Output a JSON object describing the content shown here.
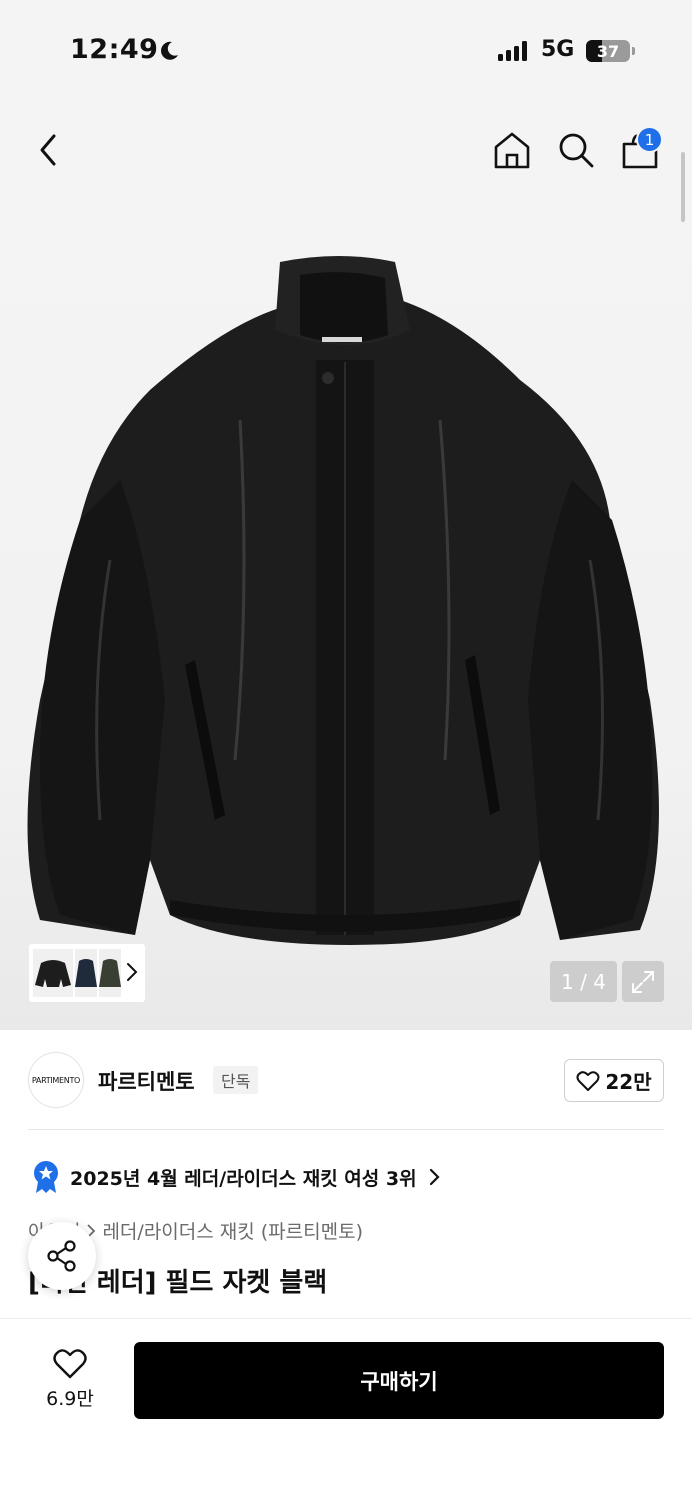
{
  "status_bar": {
    "time": "12:49",
    "network": "5G",
    "battery": "37"
  },
  "gallery": {
    "counter": "1 / 4",
    "cart_count": "1"
  },
  "brand": {
    "logo_text": "PARTIMENTO",
    "name": "파르티멘토",
    "tag": "단독",
    "likes": "22만"
  },
  "ranking": {
    "text": "2025년 4월 레더/라이더스 재킷 여성 3위"
  },
  "breadcrumb": {
    "items": [
      "아우터",
      "레더/라이더스 재킷 (파르티멘토)"
    ]
  },
  "product": {
    "title": "[비건 레더] 필드 자켓 블랙"
  },
  "bottom": {
    "wish_count": "6.9만",
    "buy_label": "구매하기"
  },
  "colors": {
    "accent": "#1e6fe8",
    "buy_button": "#000000"
  }
}
